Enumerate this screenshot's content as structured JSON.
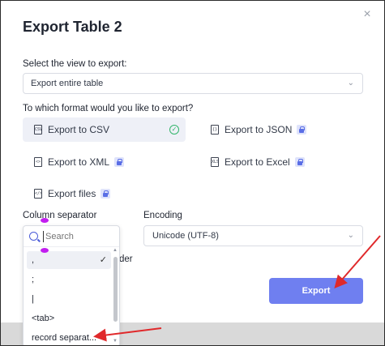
{
  "dialog": {
    "title": "Export Table 2",
    "close_icon": "close-icon"
  },
  "view": {
    "label": "Select the view to export:",
    "selected": "Export entire table"
  },
  "format": {
    "label": "To which format would you like to export?",
    "options": [
      {
        "label": "Export to CSV",
        "icon": "CSV",
        "selected": true,
        "locked": false
      },
      {
        "label": "Export to JSON",
        "icon": "{}",
        "selected": false,
        "locked": true
      },
      {
        "label": "Export to XML",
        "icon": "<>",
        "selected": false,
        "locked": true
      },
      {
        "label": "Export to Excel",
        "icon": "XLS",
        "selected": false,
        "locked": true
      },
      {
        "label": "Export files",
        "icon": "</>",
        "selected": false,
        "locked": true
      }
    ]
  },
  "separator": {
    "label": "Column separator",
    "search_placeholder": "Search",
    "options": [
      ",",
      ";",
      "|",
      "<tab>",
      "record separat..."
    ],
    "selected": ","
  },
  "encoding": {
    "label": "Encoding",
    "selected": "Unicode (UTF-8)"
  },
  "partial_label": "der",
  "export_button": "Export",
  "colors": {
    "accent": "#6f7ff0",
    "annotation_arrow": "#e0292b",
    "annotation_pin": "#c21df0",
    "check": "#33b56b"
  }
}
